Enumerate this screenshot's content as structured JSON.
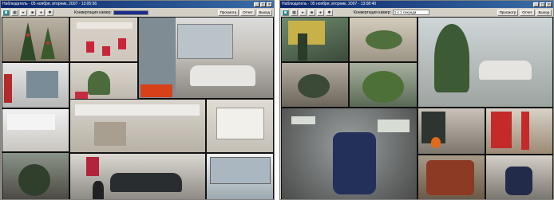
{
  "left_window": {
    "title": "Наблюдатель · 05 ноября, вторник, 2007 · 13:05:56",
    "toolbar": {
      "view_label": "Конвертация камер:",
      "btn_find": "Просмотр",
      "btn_report": "Отчет",
      "btn_exit": "Выход"
    }
  },
  "right_window": {
    "title": "Наблюдатель · 05 ноября, вторник, 2007 · 13:08:40",
    "toolbar": {
      "view_label": "Конвертация камер:",
      "select_value": "1 х 1 секунда",
      "btn_find": "Просмотр",
      "btn_report": "Отчет",
      "btn_exit": "Выход"
    }
  },
  "icons": [
    "camera-icon",
    "grid-icon",
    "play-icon",
    "stop-icon",
    "record-icon",
    "settings-icon"
  ],
  "colors": {
    "titlebar_start": "#0a246a",
    "titlebar_end": "#3a6ea5",
    "toolbar_bg": "#d4d0c8",
    "accent_teal": "#2d8a8a",
    "progress": "#1a2d8a"
  }
}
